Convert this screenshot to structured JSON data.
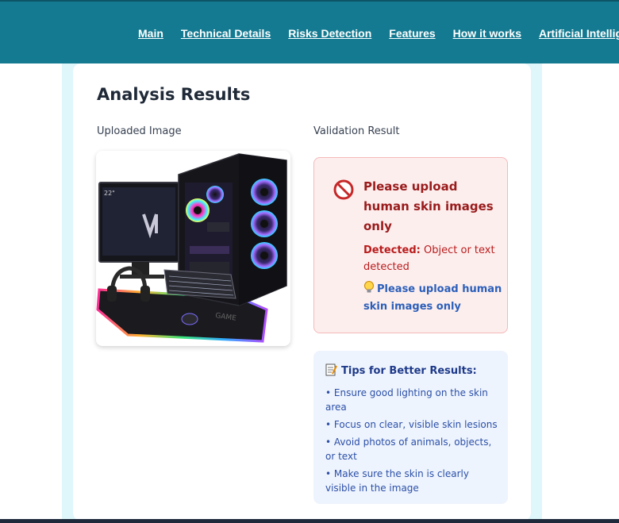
{
  "nav": {
    "items": [
      "Main",
      "Technical Details",
      "Risks Detection",
      "Features",
      "How it works",
      "Artificial Intelligence"
    ]
  },
  "results": {
    "title": "Analysis Results",
    "uploaded_label": "Uploaded Image",
    "validation_label": "Validation Result"
  },
  "validation": {
    "message": "Please upload human skin images only",
    "detected_label": "Detected:",
    "detected_value": "Object or text detected",
    "hint": "Please upload human skin images only"
  },
  "tips": {
    "title": "Tips for Better Results:",
    "items": [
      "• Ensure good lighting on the skin area",
      "• Focus on clear, visible skin lesions",
      "• Avoid photos of animals, objects, or text",
      "• Make sure the skin is clearly visible in the image"
    ]
  },
  "image": {
    "monitor_label": "22\""
  },
  "colors": {
    "header": "#137a91",
    "error_bg": "#fdeeee",
    "error_text": "#991b1b",
    "hint_text": "#2b5fb9",
    "tips_bg": "#eef4fd"
  }
}
